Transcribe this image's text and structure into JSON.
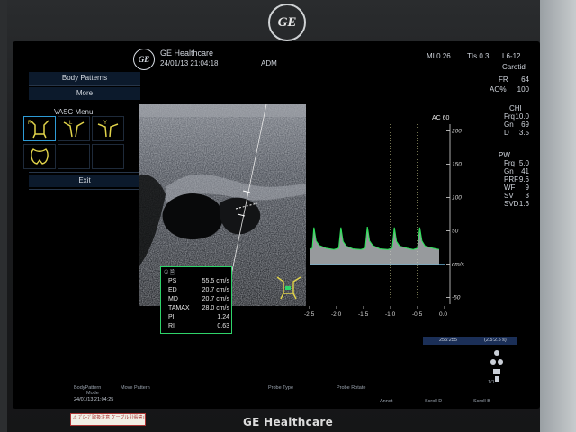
{
  "bezel": {
    "top_logo": "GE",
    "bottom_brand": "GE Healthcare",
    "warning_label": "⚠ ﾌﾟﾛｰﾌﾞ取扱注意 ケーブル引張禁止 注意"
  },
  "header": {
    "logo": "GE",
    "brand": "GE Healthcare",
    "datetime": "24/01/13 21:04:18",
    "operator": "ADM",
    "mi": "MI 0.26",
    "tis": "TIs 0.3",
    "probe": "L6-12",
    "preset": "Carotid"
  },
  "left_menu": {
    "body_patterns_label": "Body Patterns",
    "more_label": "More",
    "menu_title": "VASC Menu",
    "exit_label": "Exit",
    "pattern_tags": [
      "R",
      "L",
      "Y",
      "Y"
    ]
  },
  "image": {
    "fr_label": "FR",
    "fr_value": "64",
    "ao_label": "AO%",
    "ao_value": "100",
    "ac_label": "AC 60"
  },
  "chi": {
    "title": "CHI",
    "rows": [
      {
        "label": "Frq",
        "value": "10.0"
      },
      {
        "label": "Gn",
        "value": "69"
      },
      {
        "label": "D",
        "value": "3.5"
      }
    ]
  },
  "pw": {
    "title": "PW",
    "rows": [
      {
        "label": "Frq",
        "value": "5.0"
      },
      {
        "label": "Gn",
        "value": "41"
      },
      {
        "label": "PRF",
        "value": "9.6"
      },
      {
        "label": "WF",
        "value": "9"
      },
      {
        "label": "SV",
        "value": "3"
      },
      {
        "label": "SVD",
        "value": "1.6"
      }
    ]
  },
  "doppler_measure": {
    "header": "① 🗎",
    "rows": [
      {
        "label": "PS",
        "value": "55.5 cm/s"
      },
      {
        "label": "ED",
        "value": "20.7 cm/s"
      },
      {
        "label": "MD",
        "value": "20.7 cm/s"
      },
      {
        "label": "TAMAX",
        "value": "28.0 cm/s"
      },
      {
        "label": "PI",
        "value": "1.24"
      },
      {
        "label": "RI",
        "value": "0.63"
      }
    ]
  },
  "chart_data": {
    "type": "line",
    "title": "",
    "xlabel": "",
    "ylabel": "cm/s",
    "x_ticks": [
      "-2.5",
      "-2.0",
      "-1.5",
      "-1.0",
      "-0.5",
      "0.0"
    ],
    "y_ticks": [
      "200",
      "150",
      "100",
      "50",
      "cm/s",
      "-50"
    ],
    "xlim": [
      -2.5,
      0.0
    ],
    "ylim": [
      -60,
      210
    ],
    "series": [
      {
        "values_t": [
          -2.5,
          -2.45,
          -2.42,
          -2.38,
          -2.32,
          -2.2,
          -2.05,
          -1.96,
          -1.92,
          -1.88,
          -1.82,
          -1.7,
          -1.55,
          -1.47,
          -1.43,
          -1.39,
          -1.33,
          -1.2,
          -1.05,
          -0.97,
          -0.93,
          -0.89,
          -0.83,
          -0.7,
          -0.58,
          -0.5,
          -0.46,
          -0.42,
          -0.36,
          -0.22,
          -0.1
        ],
        "values_v": [
          22,
          24,
          55,
          35,
          28,
          24,
          22,
          24,
          55,
          34,
          27,
          23,
          22,
          24,
          56,
          35,
          28,
          23,
          22,
          24,
          55,
          34,
          27,
          24,
          22,
          24,
          55,
          35,
          27,
          24,
          22
        ]
      }
    ]
  },
  "status": {
    "field": "255:255",
    "readout": "(2.5:2.5 s)"
  },
  "bottom_bar": {
    "items": [
      "BodyPattern",
      "Move Pattern",
      "Probe Type",
      "Probe Rotate"
    ],
    "mode": "Mode",
    "datetime": "24/01/13 21:04:25",
    "annot": "Annot",
    "scroll_d": "Scroll D",
    "scroll_b": "Scroll B",
    "page": "1/1"
  }
}
